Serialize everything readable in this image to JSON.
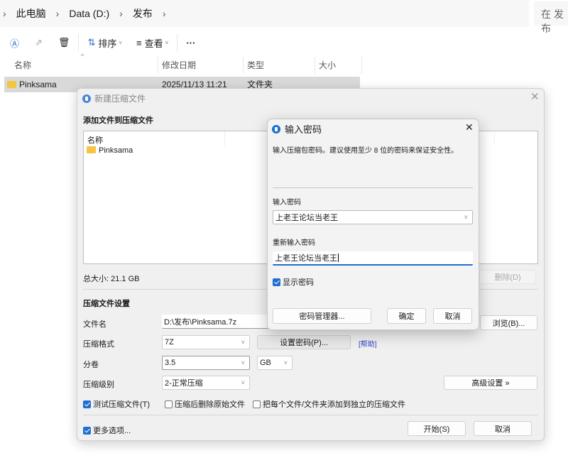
{
  "explorer": {
    "breadcrumb": [
      "此电脑",
      "Data (D:)",
      "发布"
    ],
    "search_placeholder": "在 发布",
    "toolbar": {
      "sort": "排序",
      "view": "查看",
      "more": "···"
    },
    "columns": [
      "名称",
      "修改日期",
      "类型",
      "大小"
    ],
    "rows": [
      {
        "name": "Pinksama",
        "date": "2025/11/13 11:21",
        "type": "文件夹"
      }
    ]
  },
  "archive_dialog": {
    "title": "新建压缩文件",
    "add_section": "添加文件到压缩文件",
    "list_header": "名称",
    "list_items": [
      "Pinksama"
    ],
    "total_size": "总大小: 21.1 GB",
    "delete_button": "删除(D)",
    "settings_section": "压缩文件设置",
    "filename_label": "文件名",
    "filename_value": "D:\\发布\\Pinksama.7z",
    "browse_button": "浏览(B)...",
    "format_label": "压缩格式",
    "format_value": "7Z",
    "set_password_button": "设置密码(P)...",
    "help_link": "[帮助]",
    "split_label": "分卷",
    "split_value": "3.5",
    "split_unit": "GB",
    "level_label": "压缩级别",
    "level_value": "2-正常压缩",
    "advanced_button": "高级设置 »",
    "checkboxes": [
      {
        "label": "测试压缩文件(T)",
        "checked": true
      },
      {
        "label": "压缩后删除原始文件",
        "checked": false
      },
      {
        "label": "把每个文件/文件夹添加到独立的压缩文件",
        "checked": false
      }
    ],
    "more_options": {
      "label": "更多选项...",
      "checked": true
    },
    "start_button": "开始(S)",
    "cancel_button": "取消"
  },
  "password_dialog": {
    "title": "输入密码",
    "description": "输入压缩包密码。建议使用至少 8 位的密码来保证安全性。",
    "password_label": "输入密码",
    "password_value": "上老王论坛当老王",
    "confirm_label": "重新输入密码",
    "confirm_value": "上老王论坛当老王",
    "show_password": {
      "label": "显示密码",
      "checked": true
    },
    "manager_button": "密码管理器...",
    "ok_button": "确定",
    "cancel_button": "取消"
  },
  "colors": {
    "accent": "#1e6fd0",
    "link": "#2b3fc7"
  }
}
